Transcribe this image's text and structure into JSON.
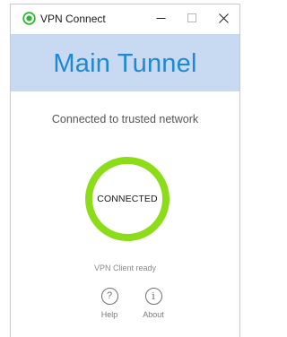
{
  "window": {
    "title": "VPN Connect",
    "controls": {
      "minimize": "minimize",
      "maximize": "maximize",
      "close": "close"
    }
  },
  "header": {
    "title": "Main Tunnel"
  },
  "status": {
    "message": "Connected to trusted network",
    "state_label": "CONNECTED",
    "client_status": "VPN Client ready"
  },
  "actions": {
    "help": {
      "label": "Help",
      "glyph": "?"
    },
    "about": {
      "label": "About",
      "glyph": "i"
    }
  },
  "colors": {
    "accent_green": "#8ddc1a",
    "header_band": "#c8d9f2",
    "header_title": "#1f88d3"
  },
  "icons": {
    "app": "vpn-status-icon",
    "help": "question-circle-icon",
    "about": "info-circle-icon"
  }
}
